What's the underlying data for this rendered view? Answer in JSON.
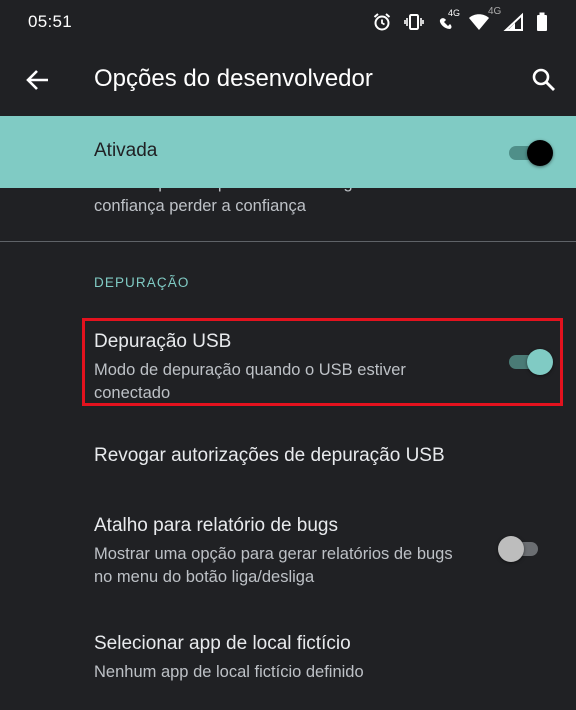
{
  "status_bar": {
    "time": "05:51",
    "icons": [
      "alarm-icon",
      "vibrate-icon",
      "volte-4g-icon",
      "wifi-icon",
      "4g-signal-icon",
      "battery-icon"
    ],
    "network_label_1": "4G",
    "network_label_2": "4G"
  },
  "app_bar": {
    "title": "Opções do desenvolvedor",
    "back_icon": "arrow-left-icon",
    "search_icon": "search-icon"
  },
  "master_switch": {
    "label": "Ativada",
    "checked": true,
    "background_color": "#80cbc4"
  },
  "partial_item": {
    "summary_line1": "será bloqueado quando o último agente de",
    "summary_line2": "confiança perder a confiança"
  },
  "section": {
    "header": "DEPURAÇÃO",
    "accent_color": "#80cbc4"
  },
  "items": [
    {
      "title": "Depuração USB",
      "summary": "Modo de depuração quando o USB estiver conectado",
      "switch": true,
      "highlighted": true
    },
    {
      "title": "Revogar autorizações de depuração USB"
    },
    {
      "title": "Atalho para relatório de bugs",
      "summary": "Mostrar uma opção para gerar relatórios de bugs no menu do botão liga/desliga",
      "switch": false
    },
    {
      "title": "Selecionar app de local fictício",
      "summary": "Nenhum app de local fictício definido"
    }
  ],
  "highlight_color": "#e3121e"
}
